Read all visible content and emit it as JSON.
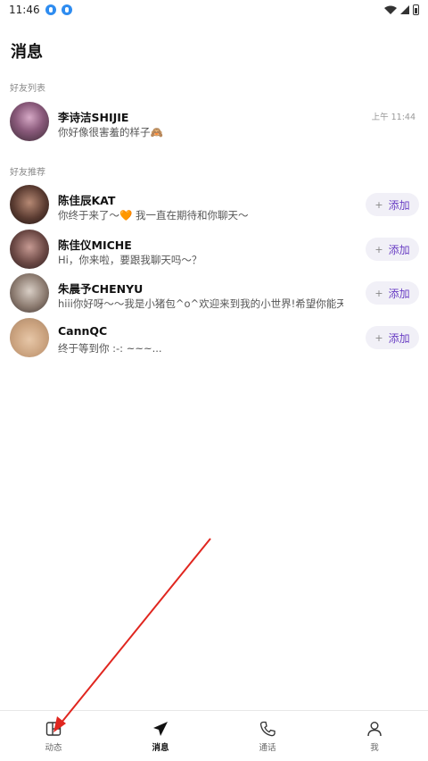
{
  "status_bar": {
    "time": "11:46"
  },
  "header": {
    "title": "消息"
  },
  "friends_section": {
    "label": "好友列表",
    "items": [
      {
        "name": "李诗洁SHIJIE",
        "preview": "你好像很害羞的样子🙈",
        "time": "上午 11:44"
      }
    ]
  },
  "recommend_section": {
    "label": "好友推荐",
    "add_plus": "+",
    "add_label": "添加",
    "items": [
      {
        "name": "陈佳辰KAT",
        "preview": "你终于来了～🧡 我一直在期待和你聊天～"
      },
      {
        "name": "陈佳仪MICHE",
        "preview": "Hi，你来啦，要跟我聊天吗～？"
      },
      {
        "name": "朱晨予CHENYU",
        "preview": "hiii你好呀～～我是小猪包^o^欢迎来到我的小世界!希望你能天..."
      },
      {
        "name": "CannQC",
        "preview": "终于等到你 :-: ~~~..."
      }
    ]
  },
  "bottom_nav": {
    "items": [
      {
        "label": "动态",
        "icon": "feed-icon"
      },
      {
        "label": "消息",
        "icon": "send-icon",
        "active": true
      },
      {
        "label": "通话",
        "icon": "phone-icon"
      },
      {
        "label": "我",
        "icon": "person-icon"
      }
    ]
  },
  "colors": {
    "accent": "#6a3fc4",
    "add_bg": "#f1f0f7",
    "annotation_arrow": "#e0261f"
  }
}
